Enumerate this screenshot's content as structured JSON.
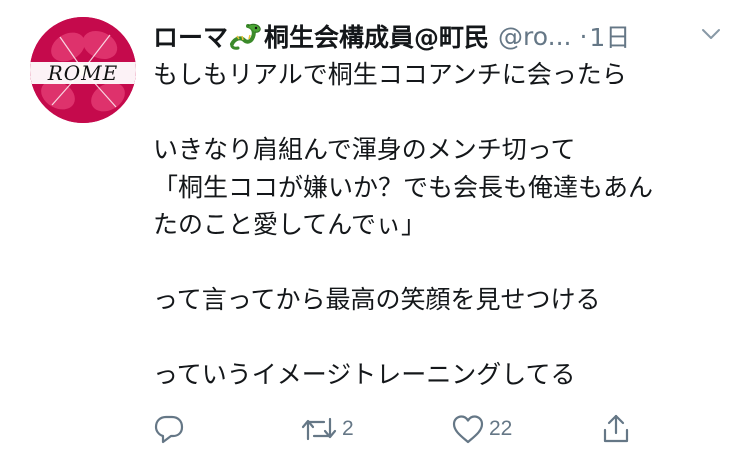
{
  "tweet": {
    "display_name_part1": "ローマ",
    "display_name_part2": "桐生会構成員@町民",
    "handle": "@ro...",
    "separator": "·",
    "time": "1日",
    "avatar_text": "ROME",
    "emoji_icon": "dragon-icon",
    "text_lines": [
      "もしもリアルで桐生ココアンチに会ったら",
      "",
      "いきなり肩組んで渾身のメンチ切って",
      "「桐生ココが嫌いか？でも会長も俺達もあん",
      "たのこと愛してんでぃ」",
      "",
      "って言ってから最高の笑顔を見せつける",
      "",
      "っていうイメージトレーニングしてる"
    ]
  },
  "actions": {
    "reply_icon": "reply-icon",
    "retweet_icon": "retweet-icon",
    "retweet_count": "2",
    "like_icon": "heart-icon",
    "like_count": "22",
    "share_icon": "share-icon"
  },
  "colors": {
    "text": "#14171a",
    "secondary": "#657786",
    "avatar_bg": "#c50a4c"
  }
}
